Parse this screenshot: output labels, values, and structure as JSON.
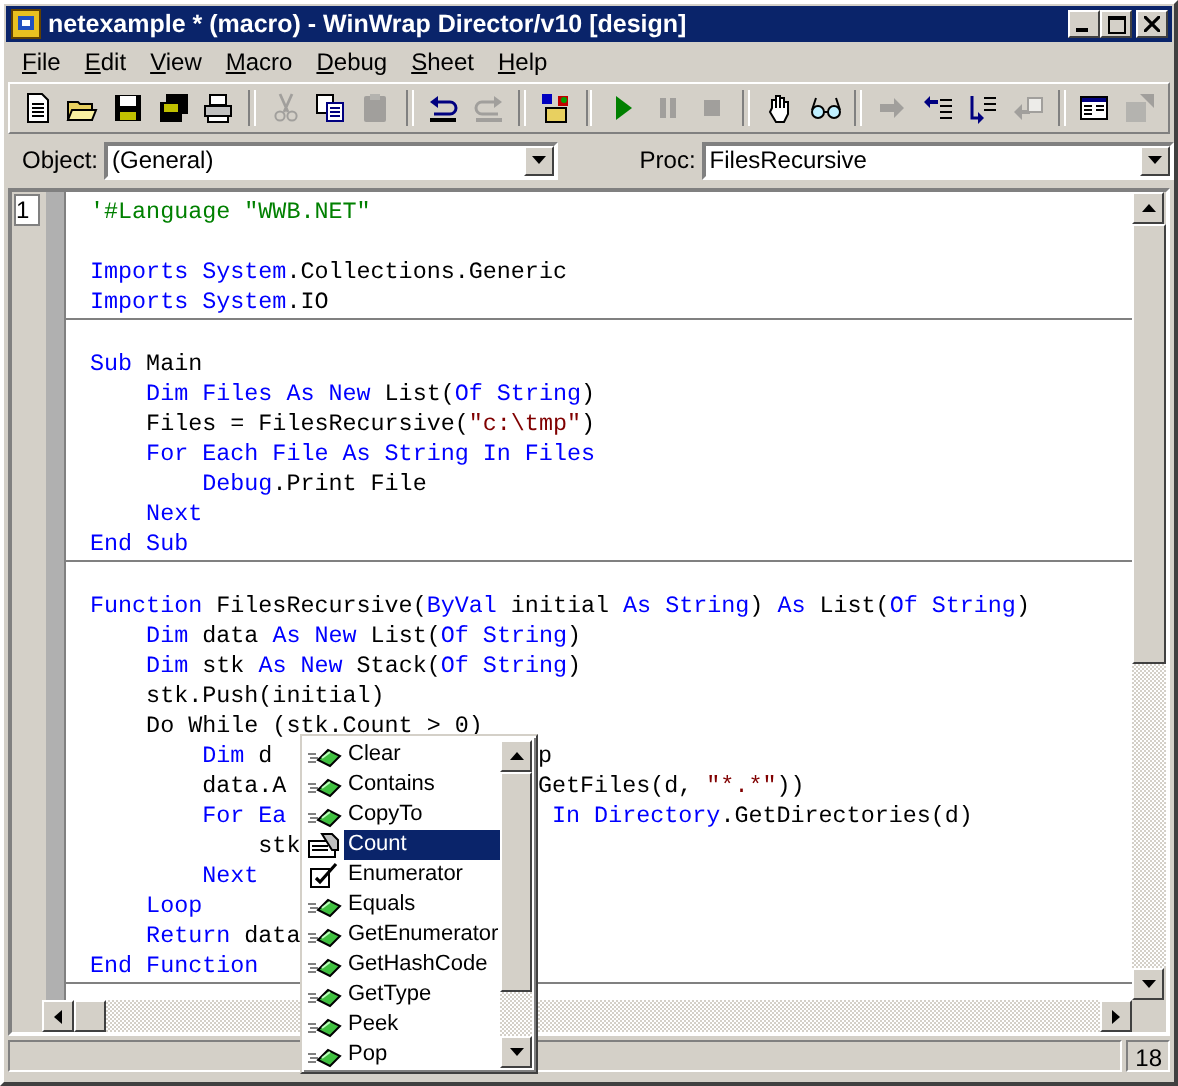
{
  "window": {
    "title": "netexample * (macro) - WinWrap Director/v10 [design]"
  },
  "menu": [
    "File",
    "Edit",
    "View",
    "Macro",
    "Debug",
    "Sheet",
    "Help"
  ],
  "toolbar": [
    {
      "buttons": [
        {
          "kind": "new",
          "disabled": false
        },
        {
          "kind": "open",
          "disabled": false
        },
        {
          "kind": "save",
          "disabled": false
        },
        {
          "kind": "save-all",
          "disabled": false
        },
        {
          "kind": "print",
          "disabled": false
        }
      ]
    },
    {
      "buttons": [
        {
          "kind": "cut",
          "disabled": true
        },
        {
          "kind": "copy",
          "disabled": false
        },
        {
          "kind": "paste",
          "disabled": true
        }
      ]
    },
    {
      "buttons": [
        {
          "kind": "undo",
          "disabled": false
        },
        {
          "kind": "redo",
          "disabled": true
        }
      ]
    },
    {
      "buttons": [
        {
          "kind": "references",
          "disabled": false
        }
      ]
    },
    {
      "buttons": [
        {
          "kind": "run",
          "disabled": false
        },
        {
          "kind": "pause",
          "disabled": true
        },
        {
          "kind": "stop",
          "disabled": true
        }
      ]
    },
    {
      "buttons": [
        {
          "kind": "hand",
          "disabled": false
        },
        {
          "kind": "watch",
          "disabled": false
        }
      ]
    },
    {
      "buttons": [
        {
          "kind": "step",
          "disabled": true
        },
        {
          "kind": "step-into",
          "disabled": false
        },
        {
          "kind": "step-over",
          "disabled": false
        },
        {
          "kind": "step-out",
          "disabled": true
        }
      ]
    },
    {
      "buttons": [
        {
          "kind": "browser",
          "disabled": false
        },
        {
          "kind": "properties",
          "disabled": true
        }
      ]
    }
  ],
  "object_selector": {
    "label": "Object:",
    "value": "(General)"
  },
  "proc_selector": {
    "label": "Proc:",
    "value": "FilesRecursive"
  },
  "editor": {
    "line_number": "1",
    "sections": [
      {
        "lines": [
          {
            "kind": "code",
            "tokens": [
              {
                "kind": "comment",
                "text": "'#Language \"WWB.NET\""
              }
            ]
          },
          {
            "kind": "blank"
          },
          {
            "kind": "code",
            "tokens": [
              {
                "kind": "keyword",
                "text": "Imports System"
              },
              {
                "kind": "text",
                "text": ".Collections.Generic"
              }
            ]
          },
          {
            "kind": "code",
            "tokens": [
              {
                "kind": "keyword",
                "text": "Imports System"
              },
              {
                "kind": "text",
                "text": ".IO"
              }
            ]
          }
        ]
      },
      {
        "lines": [
          {
            "kind": "blank"
          },
          {
            "kind": "code",
            "tokens": [
              {
                "kind": "keyword",
                "text": "Sub"
              },
              {
                "kind": "text",
                "text": " Main"
              }
            ]
          },
          {
            "kind": "code",
            "tokens": [
              {
                "kind": "keyword",
                "text": "    Dim Files As New"
              },
              {
                "kind": "text",
                "text": " List("
              },
              {
                "kind": "keyword",
                "text": "Of String"
              },
              {
                "kind": "text",
                "text": ")"
              }
            ]
          },
          {
            "kind": "code",
            "tokens": [
              {
                "kind": "text",
                "text": "    Files = FilesRecursive("
              },
              {
                "kind": "string",
                "text": "\"c:\\tmp\""
              },
              {
                "kind": "text",
                "text": ")"
              }
            ]
          },
          {
            "kind": "code",
            "tokens": [
              {
                "kind": "keyword",
                "text": "    For Each File As String In Files"
              }
            ]
          },
          {
            "kind": "code",
            "tokens": [
              {
                "kind": "keyword",
                "text": "        Debug"
              },
              {
                "kind": "text",
                "text": ".Print File"
              }
            ]
          },
          {
            "kind": "code",
            "tokens": [
              {
                "kind": "keyword",
                "text": "    Next"
              }
            ]
          },
          {
            "kind": "code",
            "tokens": [
              {
                "kind": "keyword",
                "text": "End Sub"
              }
            ]
          }
        ]
      },
      {
        "lines": [
          {
            "kind": "blank"
          },
          {
            "kind": "code",
            "tokens": [
              {
                "kind": "keyword",
                "text": "Function"
              },
              {
                "kind": "text",
                "text": " FilesRecursive("
              },
              {
                "kind": "keyword",
                "text": "ByVal"
              },
              {
                "kind": "text",
                "text": " initial "
              },
              {
                "kind": "keyword",
                "text": "As String"
              },
              {
                "kind": "text",
                "text": ") "
              },
              {
                "kind": "keyword",
                "text": "As"
              },
              {
                "kind": "text",
                "text": " List("
              },
              {
                "kind": "keyword",
                "text": "Of String"
              },
              {
                "kind": "text",
                "text": ")"
              }
            ]
          },
          {
            "kind": "code",
            "tokens": [
              {
                "kind": "keyword",
                "text": "    Dim"
              },
              {
                "kind": "text",
                "text": " data "
              },
              {
                "kind": "keyword",
                "text": "As New"
              },
              {
                "kind": "text",
                "text": " List("
              },
              {
                "kind": "keyword",
                "text": "Of String"
              },
              {
                "kind": "text",
                "text": ")"
              }
            ]
          },
          {
            "kind": "code",
            "tokens": [
              {
                "kind": "keyword",
                "text": "    Dim"
              },
              {
                "kind": "text",
                "text": " stk "
              },
              {
                "kind": "keyword",
                "text": "As New"
              },
              {
                "kind": "text",
                "text": " Stack("
              },
              {
                "kind": "keyword",
                "text": "Of String"
              },
              {
                "kind": "text",
                "text": ")"
              }
            ]
          },
          {
            "kind": "code",
            "tokens": [
              {
                "kind": "text",
                "text": "    stk.Push(initial)"
              }
            ]
          },
          {
            "kind": "code",
            "tokens": [
              {
                "kind": "text",
                "text": "    Do While (stk.Count > 0)"
              }
            ]
          },
          {
            "kind": "code",
            "tokens": [
              {
                "kind": "keyword",
                "text": "        Dim"
              },
              {
                "kind": "text",
                "text": " d"
              }
            ],
            "after": [
              {
                "kind": "text",
                "text": "p"
              }
            ]
          },
          {
            "kind": "code",
            "tokens": [
              {
                "kind": "text",
                "text": "        data.A"
              }
            ],
            "after": [
              {
                "kind": "text",
                "text": "GetFiles(d, "
              },
              {
                "kind": "string",
                "text": "\"*.*\""
              },
              {
                "kind": "text",
                "text": "))"
              }
            ]
          },
          {
            "kind": "code",
            "tokens": [
              {
                "kind": "keyword",
                "text": "        For Ea"
              }
            ],
            "after": [
              {
                "kind": "keyword",
                "text": " In Directory"
              },
              {
                "kind": "text",
                "text": ".GetDirectories(d)"
              }
            ]
          },
          {
            "kind": "code",
            "tokens": [
              {
                "kind": "text",
                "text": "            stk"
              }
            ]
          },
          {
            "kind": "code",
            "tokens": [
              {
                "kind": "keyword",
                "text": "        Next"
              }
            ]
          },
          {
            "kind": "code",
            "tokens": [
              {
                "kind": "keyword",
                "text": "    Loop"
              }
            ]
          },
          {
            "kind": "code",
            "tokens": [
              {
                "kind": "keyword",
                "text": "    Return"
              },
              {
                "kind": "text",
                "text": " data"
              }
            ]
          },
          {
            "kind": "code",
            "tokens": [
              {
                "kind": "keyword",
                "text": "End Function"
              }
            ]
          }
        ]
      }
    ]
  },
  "completion": {
    "items": [
      {
        "label": "Clear",
        "kind": "method",
        "selected": false
      },
      {
        "label": "Contains",
        "kind": "method",
        "selected": false
      },
      {
        "label": "CopyTo",
        "kind": "method",
        "selected": false
      },
      {
        "label": "Count",
        "kind": "property",
        "selected": true
      },
      {
        "label": "Enumerator",
        "kind": "type",
        "selected": false
      },
      {
        "label": "Equals",
        "kind": "method",
        "selected": false
      },
      {
        "label": "GetEnumerator",
        "kind": "method",
        "selected": false
      },
      {
        "label": "GetHashCode",
        "kind": "method",
        "selected": false
      },
      {
        "label": "GetType",
        "kind": "method",
        "selected": false
      },
      {
        "label": "Peek",
        "kind": "method",
        "selected": false
      },
      {
        "label": "Pop",
        "kind": "method",
        "selected": false
      }
    ]
  },
  "status_bar": {
    "panel": "18"
  }
}
